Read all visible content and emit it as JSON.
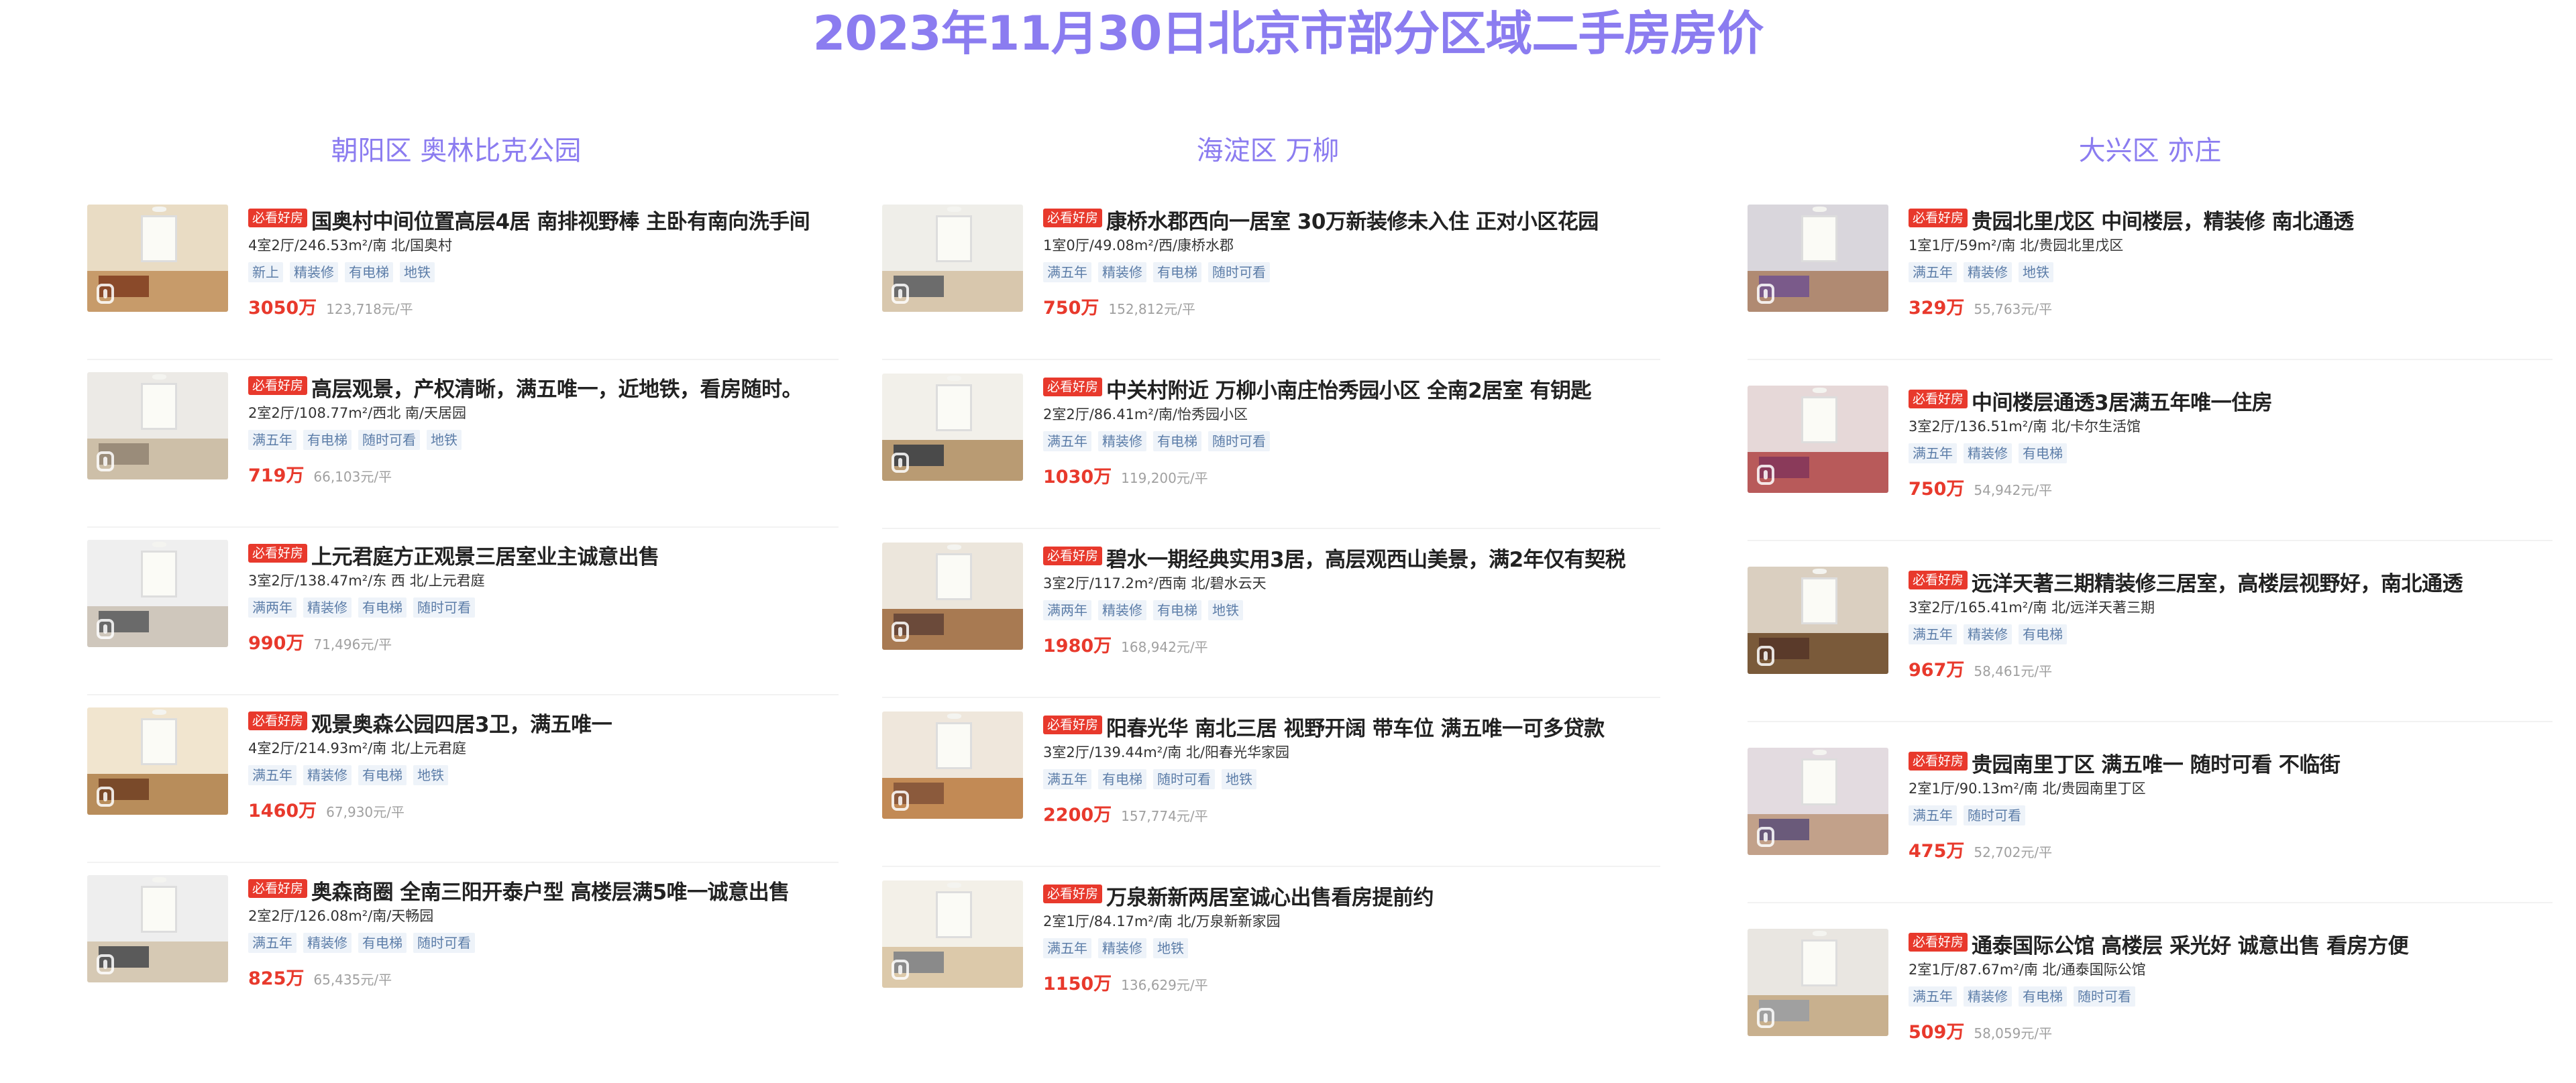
{
  "page_title": "2023年11月30日北京市部分区域二手房房价",
  "columns": [
    {
      "title": "朝阳区 奥林比克公园",
      "listings": [
        {
          "tag": "必看好房",
          "title": "国奥村中间位置高层4居 南排视野棒 主卧有南向洗手间",
          "meta": "4室2厅/246.53m²/南 北/国奥村",
          "chips": [
            "新上",
            "精装修",
            "有电梯",
            "地铁"
          ],
          "price": "3050万",
          "unit_price": "123,718元/平"
        },
        {
          "tag": "必看好房",
          "title": "高层观景，产权清晰，满五唯一，近地铁，看房随时。",
          "meta": "2室2厅/108.77m²/西北 南/天居园",
          "chips": [
            "满五年",
            "有电梯",
            "随时可看",
            "地铁"
          ],
          "price": "719万",
          "unit_price": "66,103元/平"
        },
        {
          "tag": "必看好房",
          "title": "上元君庭方正观景三居室业主诚意出售",
          "meta": "3室2厅/138.47m²/东 西 北/上元君庭",
          "chips": [
            "满两年",
            "精装修",
            "有电梯",
            "随时可看"
          ],
          "price": "990万",
          "unit_price": "71,496元/平"
        },
        {
          "tag": "必看好房",
          "title": "观景奥森公园四居3卫，满五唯一",
          "meta": "4室2厅/214.93m²/南 北/上元君庭",
          "chips": [
            "满五年",
            "精装修",
            "有电梯",
            "地铁"
          ],
          "price": "1460万",
          "unit_price": "67,930元/平"
        },
        {
          "tag": "必看好房",
          "title": "奥森商圈 全南三阳开泰户型 高楼层满5唯一诚意出售",
          "meta": "2室2厅/126.08m²/南/天畅园",
          "chips": [
            "满五年",
            "精装修",
            "有电梯",
            "随时可看"
          ],
          "price": "825万",
          "unit_price": "65,435元/平"
        }
      ]
    },
    {
      "title": "海淀区 万柳",
      "listings": [
        {
          "tag": "必看好房",
          "title": "康桥水郡西向一居室 30万新装修未入住 正对小区花园",
          "meta": "1室0厅/49.08m²/西/康桥水郡",
          "chips": [
            "满五年",
            "精装修",
            "有电梯",
            "随时可看"
          ],
          "price": "750万",
          "unit_price": "152,812元/平"
        },
        {
          "tag": "必看好房",
          "title": "中关村附近 万柳小南庄怡秀园小区 全南2居室 有钥匙",
          "meta": "2室2厅/86.41m²/南/怡秀园小区",
          "chips": [
            "满五年",
            "精装修",
            "有电梯",
            "随时可看"
          ],
          "price": "1030万",
          "unit_price": "119,200元/平"
        },
        {
          "tag": "必看好房",
          "title": "碧水一期经典实用3居，高层观西山美景，满2年仅有契税",
          "meta": "3室2厅/117.2m²/西南 北/碧水云天",
          "chips": [
            "满两年",
            "精装修",
            "有电梯",
            "地铁"
          ],
          "price": "1980万",
          "unit_price": "168,942元/平"
        },
        {
          "tag": "必看好房",
          "title": "阳春光华 南北三居 视野开阔 带车位 满五唯一可多贷款",
          "meta": "3室2厅/139.44m²/南 北/阳春光华家园",
          "chips": [
            "满五年",
            "有电梯",
            "随时可看",
            "地铁"
          ],
          "price": "2200万",
          "unit_price": "157,774元/平"
        },
        {
          "tag": "必看好房",
          "title": "万泉新新两居室诚心出售看房提前约",
          "meta": "2室1厅/84.17m²/南 北/万泉新新家园",
          "chips": [
            "满五年",
            "精装修",
            "地铁"
          ],
          "price": "1150万",
          "unit_price": "136,629元/平"
        }
      ]
    },
    {
      "title": "大兴区 亦庄",
      "listings": [
        {
          "tag": "必看好房",
          "title": "贵园北里戊区 中间楼层，精装修 南北通透",
          "meta": "1室1厅/59m²/南 北/贵园北里戊区",
          "chips": [
            "满五年",
            "精装修",
            "地铁"
          ],
          "price": "329万",
          "unit_price": "55,763元/平"
        },
        {
          "tag": "必看好房",
          "title": "中间楼层通透3居满五年唯一住房",
          "meta": "3室2厅/136.51m²/南 北/卡尔生活馆",
          "chips": [
            "满五年",
            "精装修",
            "有电梯"
          ],
          "price": "750万",
          "unit_price": "54,942元/平"
        },
        {
          "tag": "必看好房",
          "title": "远洋天著三期精装修三居室，高楼层视野好，南北通透",
          "meta": "3室2厅/165.41m²/南 北/远洋天著三期",
          "chips": [
            "满五年",
            "精装修",
            "有电梯"
          ],
          "price": "967万",
          "unit_price": "58,461元/平"
        },
        {
          "tag": "必看好房",
          "title": "贵园南里丁区 满五唯一 随时可看 不临街",
          "meta": "2室1厅/90.13m²/南 北/贵园南里丁区",
          "chips": [
            "满五年",
            "随时可看"
          ],
          "price": "475万",
          "unit_price": "52,702元/平"
        },
        {
          "tag": "必看好房",
          "title": "通泰国际公馆 高楼层 采光好 诚意出售 看房方便",
          "meta": "2室1厅/87.67m²/南 北/通泰国际公馆",
          "chips": [
            "满五年",
            "精装修",
            "有电梯",
            "随时可看"
          ],
          "price": "509万",
          "unit_price": "58,059元/平"
        }
      ]
    }
  ]
}
